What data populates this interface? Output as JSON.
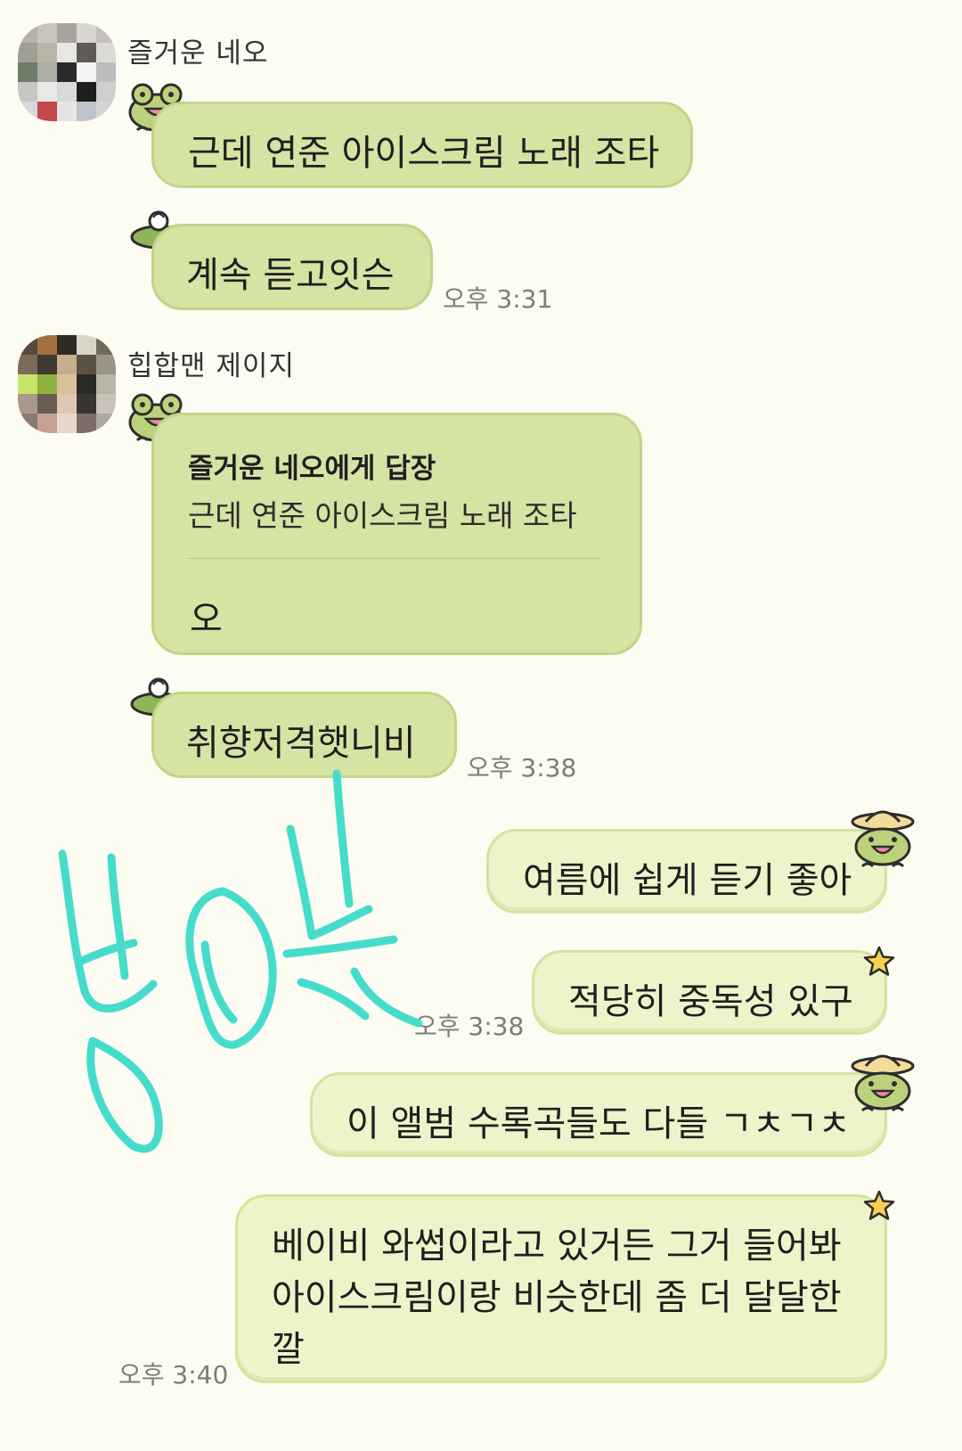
{
  "messages": [
    {
      "sender": "즐거운 네오",
      "text": "근데 연준 아이스크림 노래 조타"
    },
    {
      "text": "계속 듣고잇슨",
      "time": "오후 3:31"
    },
    {
      "sender": "힙합맨 제이지",
      "reply_header": "즐거운 네오에게 답장",
      "reply_quote": "근데 연준 아이스크림 노래 조타",
      "text": "오"
    },
    {
      "text": "취향저격햇니비",
      "time": "오후 3:38"
    },
    {
      "text": "여름에 쉽게 듣기 좋아"
    },
    {
      "text": "적당히 중독성 있구",
      "time": "오후 3:38"
    },
    {
      "text": "이 앨범 수록곡들도 다들 ㄱㅊㄱㅊ"
    },
    {
      "lines": [
        "베이비 와썹이라고 있거든 그거 들어봐",
        "아이스크림이랑 비슷한데 좀 더 달달한",
        "깔"
      ],
      "time": "오후 3:40"
    }
  ],
  "colors": {
    "background": "#fdfcf3",
    "bubble_dark": "#d5e3a3",
    "bubble_light": "#eef3c9",
    "handwriting": "#45dccb"
  },
  "icons": [
    "frog-sticker-icon",
    "lilypad-sticker-icon",
    "frog-hat-sticker-icon",
    "star-sticker-icon"
  ]
}
